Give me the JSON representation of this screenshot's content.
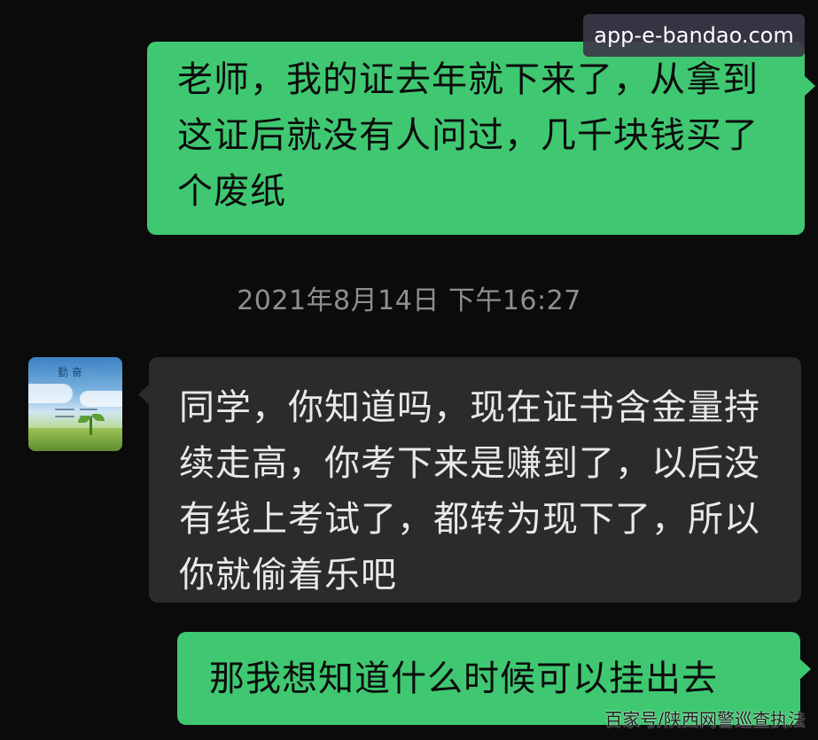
{
  "messages": [
    {
      "direction": "outgoing",
      "text": "老师，我的证去年就下来了，从拿到这证后就没有人问过，几千块钱买了个废纸"
    },
    {
      "direction": "incoming",
      "text": "同学，你知道吗，现在证书含金量持续走高，你考下来是赚到了，以后没有线上考试了，都转为现下了，所以你就偷着乐吧"
    },
    {
      "direction": "outgoing",
      "text": "那我想知道什么时候可以挂出去"
    }
  ],
  "timestamp": "2021年8月14日 下午16:27",
  "avatar": {
    "title": "勤 奋"
  },
  "watermarks": {
    "top": "app-e-bandao.com",
    "bottom": "百家号/陕西网警巡查执法"
  },
  "colors": {
    "background": "#0b0b0b",
    "outgoing_bubble": "#3fc871",
    "incoming_bubble": "#2b2b2b",
    "timestamp_text": "#8f8f8f"
  }
}
